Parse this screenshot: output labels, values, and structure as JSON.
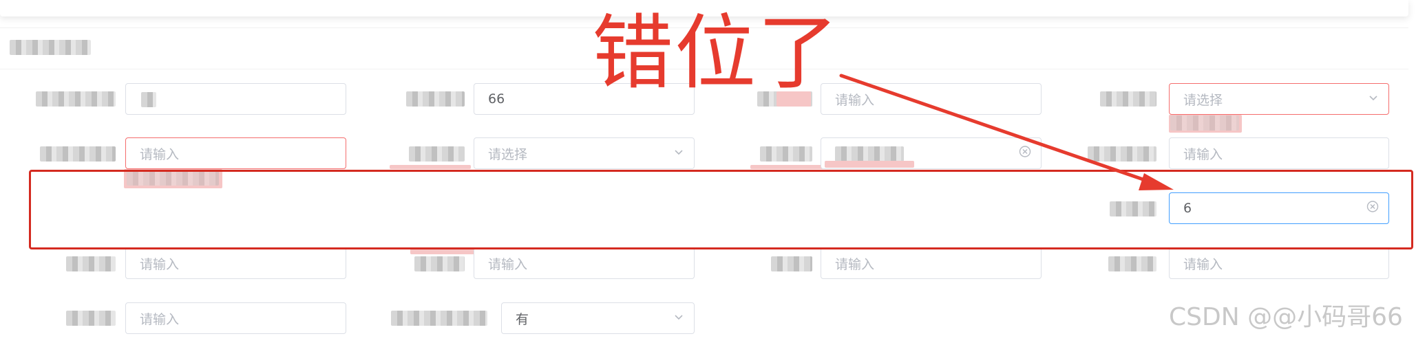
{
  "form": {
    "row1": {
      "c2_value": "66",
      "c3_placeholder": "请输入",
      "c4_placeholder": "请选择"
    },
    "row2": {
      "c1_placeholder": "请输入",
      "c2_placeholder": "请选择",
      "c4_placeholder": "请输入"
    },
    "row3": {
      "c4_value": "6"
    },
    "row4": {
      "c1_placeholder": "请输入",
      "c2_placeholder": "请输入",
      "c3_placeholder": "请输入",
      "c4_placeholder": "请输入"
    },
    "row5": {
      "c1_placeholder": "请输入",
      "c2_value": "有"
    }
  },
  "annotation": {
    "text": "错位了",
    "color": "#e63b2e"
  },
  "watermark": "CSDN @@小码哥66",
  "icons": {
    "select": "chevron-down-icon",
    "clear": "circle-close-icon",
    "arrow": "arrow-annotation"
  },
  "colors": {
    "error_border": "#f56c6c",
    "focus_border": "#409eff",
    "annotation_box": "#d42a20"
  }
}
